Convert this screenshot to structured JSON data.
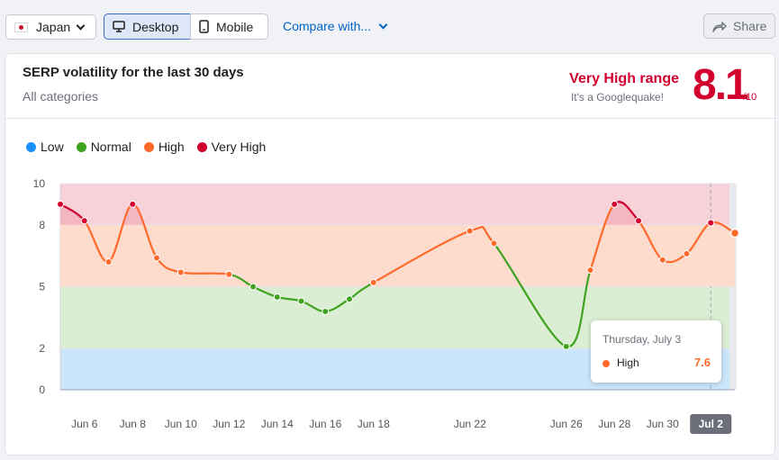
{
  "toolbar": {
    "country": "Japan",
    "device_desktop": "Desktop",
    "device_mobile": "Mobile",
    "compare": "Compare with...",
    "share": "Share"
  },
  "card": {
    "title": "SERP volatility for the last 30 days",
    "subtitle": "All categories",
    "range_label": "Very High range",
    "range_note": "It's a Googlequake!",
    "score": "8.1",
    "score_denom": "/10"
  },
  "colors": {
    "low": "#1a90ff",
    "normal": "#3fa31f",
    "high": "#ff6a2b",
    "very_high": "#d1002f",
    "accent_blue": "#0063c8"
  },
  "chart_data": {
    "type": "line",
    "legend": [
      {
        "name": "Low",
        "color": "#1a90ff"
      },
      {
        "name": "Normal",
        "color": "#3fa31f"
      },
      {
        "name": "High",
        "color": "#ff6a2b"
      },
      {
        "name": "Very High",
        "color": "#d1002f"
      }
    ],
    "bands": [
      {
        "name": "Low",
        "from": 0,
        "to": 2,
        "fill": "#cbe6fb"
      },
      {
        "name": "Normal",
        "from": 2,
        "to": 5,
        "fill": "#dbeed3"
      },
      {
        "name": "High",
        "from": 5,
        "to": 8,
        "fill": "#fddcce"
      },
      {
        "name": "Very High",
        "from": 8,
        "to": 10,
        "fill": "#f7d3d9"
      }
    ],
    "ylim": [
      0,
      10
    ],
    "yticks": [
      0,
      2,
      5,
      8,
      10
    ],
    "x_tick_labels": [
      "Jun 6",
      "Jun 8",
      "Jun 10",
      "Jun 12",
      "Jun 14",
      "Jun 16",
      "Jun 18",
      "Jun 22",
      "Jun 26",
      "Jun 28",
      "Jun 30",
      "Jul 2"
    ],
    "x_tick_days": [
      6,
      8,
      10,
      12,
      14,
      16,
      18,
      22,
      26,
      28,
      30,
      32
    ],
    "highlighted_tick": "Jul 2",
    "series": [
      {
        "x": [
          5,
          6,
          7,
          8,
          9,
          10,
          12,
          13,
          14,
          15,
          16,
          17,
          18,
          22,
          23,
          26,
          27,
          28,
          29,
          30,
          31,
          32,
          33
        ],
        "y": [
          9.0,
          8.2,
          6.2,
          9.0,
          6.4,
          5.7,
          5.6,
          5.0,
          4.5,
          4.3,
          3.8,
          4.4,
          5.2,
          7.7,
          7.1,
          2.1,
          5.8,
          9.0,
          8.2,
          6.3,
          6.6,
          8.1,
          7.6
        ],
        "colors": [
          "very_high",
          "very_high",
          "high",
          "very_high",
          "high",
          "high",
          "high",
          "normal",
          "normal",
          "normal",
          "normal",
          "normal",
          "high",
          "high",
          "high",
          "normal",
          "high",
          "very_high",
          "very_high",
          "high",
          "high",
          "very_high",
          "high"
        ]
      }
    ]
  },
  "tooltip": {
    "date": "Thursday, July 3",
    "label": "High",
    "value": "7.6"
  }
}
